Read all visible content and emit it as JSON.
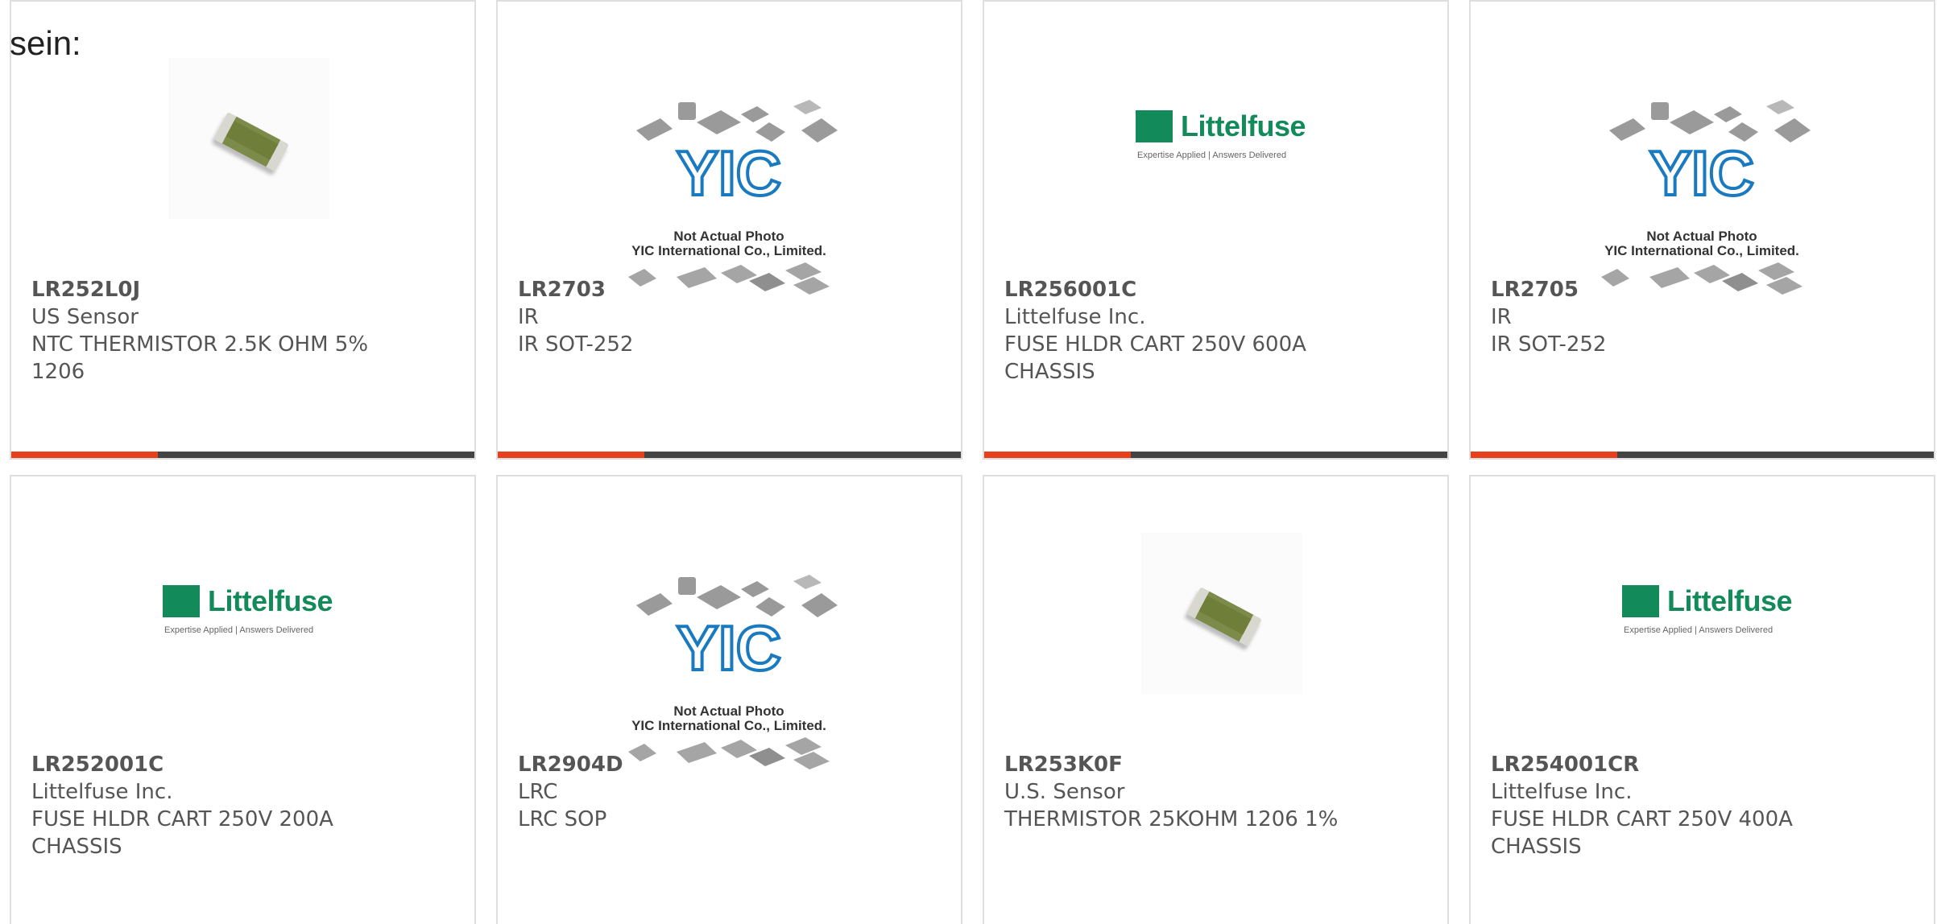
{
  "intro_text": "sein:",
  "colors": {
    "accent": "#e8401c",
    "bar": "#444444",
    "text": "#555555",
    "littelfuse_green": "#128a5a"
  },
  "products": [
    {
      "part": "LR252L0J",
      "maker": "US Sensor",
      "desc_lines": [
        "NTC THERMISTOR 2.5K OHM 5%",
        "1206"
      ],
      "image": "thermistor-chip"
    },
    {
      "part": "LR2703",
      "maker": "IR",
      "desc_lines": [
        "IR SOT-252"
      ],
      "image": "yic-placeholder"
    },
    {
      "part": "LR256001C",
      "maker": "Littelfuse Inc.",
      "desc_lines": [
        "FUSE HLDR CART 250V 600A",
        "CHASSIS"
      ],
      "image": "littelfuse-logo"
    },
    {
      "part": "LR2705",
      "maker": "IR",
      "desc_lines": [
        "IR SOT-252"
      ],
      "image": "yic-placeholder"
    },
    {
      "part": "LR252001C",
      "maker": "Littelfuse Inc.",
      "desc_lines": [
        "FUSE HLDR CART 250V 200A",
        "CHASSIS"
      ],
      "image": "littelfuse-logo"
    },
    {
      "part": "LR2904D",
      "maker": "LRC",
      "desc_lines": [
        "LRC SOP"
      ],
      "image": "yic-placeholder"
    },
    {
      "part": "LR253K0F",
      "maker": "U.S. Sensor",
      "desc_lines": [
        "THERMISTOR 25KOHM 1206 1%"
      ],
      "image": "thermistor-chip"
    },
    {
      "part": "LR254001CR",
      "maker": "Littelfuse Inc.",
      "desc_lines": [
        "FUSE HLDR CART 250V 400A",
        "CHASSIS"
      ],
      "image": "littelfuse-logo"
    }
  ],
  "logos": {
    "littelfuse": {
      "word": "Littelfuse",
      "tagline": "Expertise Applied | Answers Delivered"
    },
    "yic": {
      "mark": "YIC",
      "line1": "Not Actual Photo",
      "line2": "YIC International Co., Limited."
    }
  }
}
